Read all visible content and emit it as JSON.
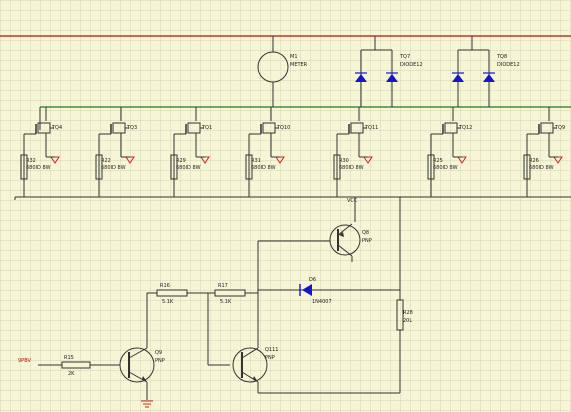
{
  "colors": {
    "background": "#f6f5d6",
    "grid": "#c9c8a6",
    "wire": "#333333",
    "power_rail": "#b01010",
    "bus_rail": "#1e7a1e",
    "diode": "#1515cc",
    "ground": "#cc2222"
  },
  "net_labels": {
    "vcc": "VCC",
    "input": "9PBV"
  },
  "meter": {
    "ref": "M1",
    "name": "METER"
  },
  "diode_pairs": [
    {
      "ref": "TQ7",
      "type": "DIODE12"
    },
    {
      "ref": "TQ8",
      "type": "DIODE12"
    }
  ],
  "mosfet_stages": [
    {
      "q": "TQ4",
      "r": "R32",
      "r_value": "680ID 8W"
    },
    {
      "q": "TQ3",
      "r": "R22",
      "r_value": "680ID 8W"
    },
    {
      "q": "TQ1",
      "r": "R29",
      "r_value": "680ID 8W"
    },
    {
      "q": "TQ10",
      "r": "R31",
      "r_value": "680ID 8W"
    },
    {
      "q": "TQ11",
      "r": "R30",
      "r_value": "680ID 8W"
    },
    {
      "q": "TQ12",
      "r": "R25",
      "r_value": "680ID 8W"
    },
    {
      "q": "TQ9",
      "r": "R26",
      "r_value": "680ID 8W"
    }
  ],
  "transistors": {
    "q8": {
      "ref": "Q8",
      "type": "PNP"
    },
    "q9": {
      "ref": "Q9",
      "type": "PNP"
    },
    "q11": {
      "ref": "Q111",
      "type": "PNP"
    }
  },
  "resistors": {
    "r15": {
      "ref": "R15",
      "value": "2K"
    },
    "r16": {
      "ref": "R16",
      "value": "5.1K"
    },
    "r17": {
      "ref": "R17",
      "value": "5.1K"
    },
    "r28": {
      "ref": "R28",
      "value": "20L"
    }
  },
  "diode_d6": {
    "ref": "D6",
    "type": "1N4007"
  }
}
